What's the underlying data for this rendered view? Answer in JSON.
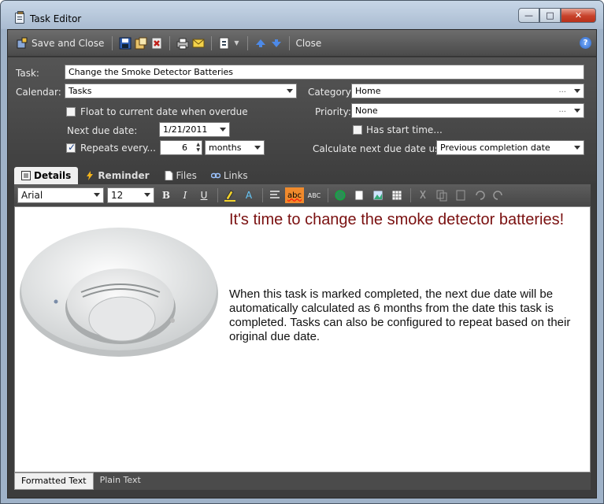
{
  "window": {
    "title": "Task Editor"
  },
  "toolbar": {
    "save_close_label": "Save and Close",
    "close_label": "Close"
  },
  "form": {
    "task_label": "Task:",
    "task_value": "Change the Smoke Detector Batteries",
    "calendar_label": "Calendar:",
    "calendar_value": "Tasks",
    "category_label": "Category:",
    "category_value": "Home",
    "float_label": "Float to current date when overdue",
    "float_checked": false,
    "priority_label": "Priority:",
    "priority_value": "None",
    "next_due_label": "Next due date:",
    "next_due_value": "1/21/2011",
    "has_start_label": "Has start time...",
    "has_start_checked": false,
    "repeats_label": "Repeats every...",
    "repeats_checked": true,
    "repeats_count": "6",
    "repeats_unit": "months",
    "calc_label": "Calculate next due date using:",
    "calc_value": "Previous completion date",
    "ellipsis": "..."
  },
  "tabs": [
    {
      "label": "Details",
      "active": true,
      "icon": "details-icon"
    },
    {
      "label": "Reminder",
      "active": false,
      "icon": "lightning-icon"
    },
    {
      "label": "Files",
      "active": false,
      "icon": "file-icon"
    },
    {
      "label": "Links",
      "active": false,
      "icon": "link-icon"
    }
  ],
  "format_bar": {
    "font_name": "Arial",
    "font_size": "12",
    "bold": "B",
    "italic": "I",
    "underline": "U",
    "font_color": "A",
    "spell_check": "abc",
    "spell_check_2": "ABC"
  },
  "editor": {
    "title": "It's time to change the smoke detector batteries!",
    "body": "When this task is marked completed, the next due date will be automatically calculated as 6 months from the date this task is completed. Tasks can also be configured to repeat based on their original due date."
  },
  "bottom_tabs": [
    {
      "label": "Formatted Text",
      "active": true
    },
    {
      "label": "Plain Text",
      "active": false
    }
  ],
  "colors": {
    "title_text": "#7a1010",
    "accent_blue": "#2a64c4",
    "toolbar_bg": "#4a4a4a"
  }
}
